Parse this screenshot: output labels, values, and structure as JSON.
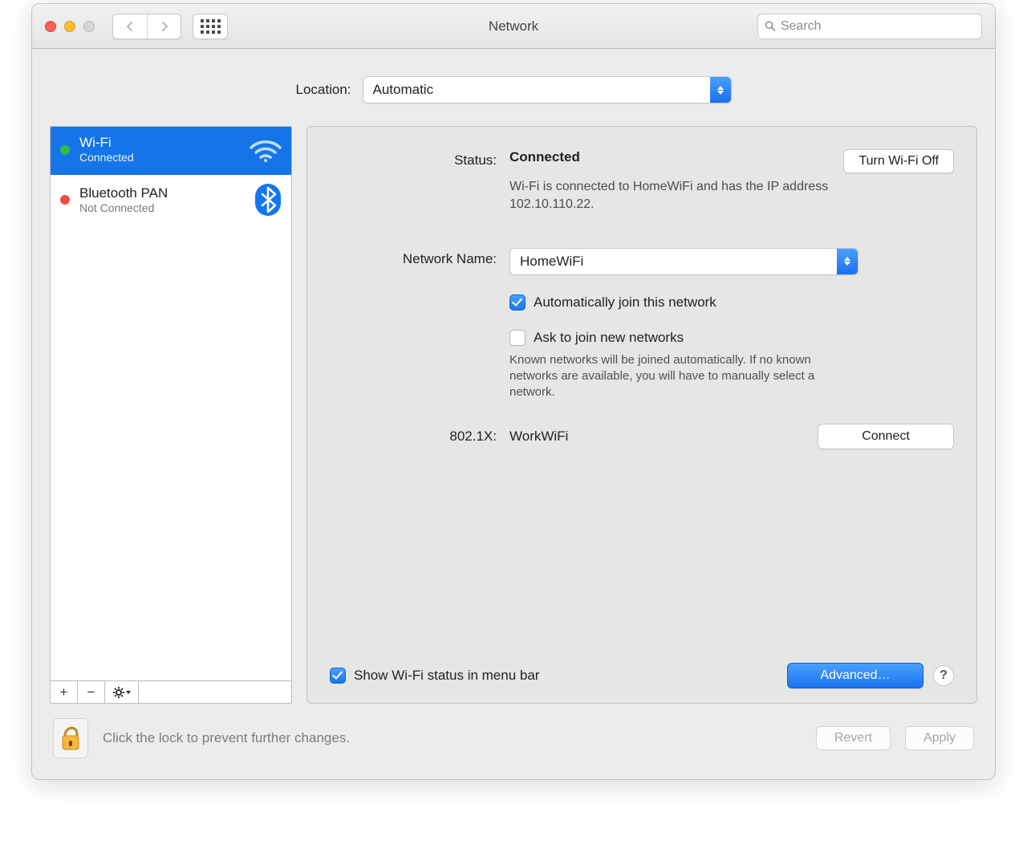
{
  "title": "Network",
  "search": {
    "placeholder": "Search"
  },
  "location": {
    "label": "Location:",
    "value": "Automatic"
  },
  "sidebar": {
    "items": [
      {
        "name": "Wi-Fi",
        "sub": "Connected",
        "dot": "green",
        "icon": "wifi",
        "selected": true
      },
      {
        "name": "Bluetooth PAN",
        "sub": "Not Connected",
        "dot": "red",
        "icon": "bluetooth",
        "selected": false
      }
    ],
    "footer": {
      "add": "+",
      "remove": "−",
      "gear": "⚙"
    }
  },
  "panel": {
    "status_label": "Status:",
    "status_value": "Connected",
    "toggle_label": "Turn Wi-Fi Off",
    "status_desc": "Wi-Fi is connected to HomeWiFi and has the IP address 102.10.110.22.",
    "netname_label": "Network Name:",
    "netname_value": "HomeWiFi",
    "auto_join": {
      "checked": true,
      "label": "Automatically join this network"
    },
    "ask_join": {
      "checked": false,
      "label": "Ask to join new networks",
      "hint": "Known networks will be joined automatically. If no known networks are available, you will have to manually select a network."
    },
    "dot1x_label": "802.1X:",
    "dot1x_value": "WorkWiFi",
    "connect_label": "Connect",
    "show_menu": {
      "checked": true,
      "label": "Show Wi-Fi status in menu bar"
    },
    "advanced_label": "Advanced…"
  },
  "bottom": {
    "lock_text": "Click the lock to prevent further changes.",
    "revert": "Revert",
    "apply": "Apply"
  }
}
